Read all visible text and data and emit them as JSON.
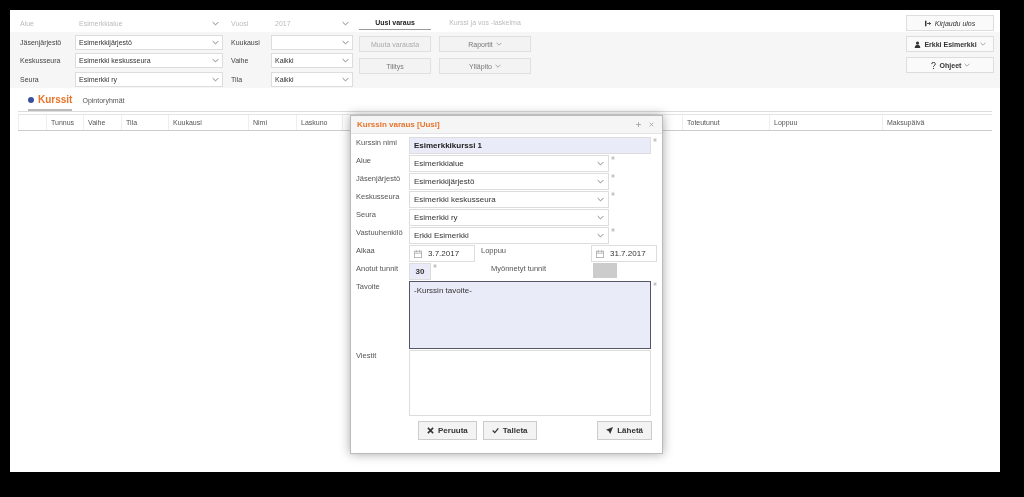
{
  "filters_left": [
    {
      "label": "Alue",
      "value": "Esimerkkialue",
      "disabled": true
    },
    {
      "label": "Jäsenjärjestö",
      "value": "Esimerkkijärjestö",
      "disabled": false
    },
    {
      "label": "Keskusseura",
      "value": "Esimerkki keskusseura",
      "disabled": false
    },
    {
      "label": "Seura",
      "value": "Esimerkki ry",
      "disabled": false
    }
  ],
  "filters_right": [
    {
      "label": "Vuosi",
      "value": "2017",
      "disabled": true
    },
    {
      "label": "Kuukausi",
      "disabled": false
    },
    {
      "label": "Vaihe",
      "value": "Kaikki",
      "disabled": false
    },
    {
      "label": "Tila",
      "value": "Kaikki",
      "disabled": false
    }
  ],
  "actions": [
    {
      "label": "Uusi varaus",
      "kind": "link",
      "disabled": false
    },
    {
      "label": "Kurssi ja vos -laskelma",
      "kind": "link",
      "disabled": true
    },
    {
      "label": "Muuta varausta",
      "kind": "button",
      "disabled": true,
      "dropdown": false
    },
    {
      "label": "Raportit",
      "kind": "button",
      "disabled": false,
      "dropdown": true
    },
    {
      "label": "Tilitys",
      "kind": "button",
      "disabled": false,
      "dropdown": false
    },
    {
      "label": "Ylläpito",
      "kind": "button",
      "disabled": false,
      "dropdown": true
    }
  ],
  "account": {
    "logout": "Kirjaudu ulos",
    "user": "Erkki Esimerkki",
    "help": "Ohjeet"
  },
  "tabs": [
    {
      "label": "Kurssit",
      "selected": true
    },
    {
      "label": "Opintoryhmät",
      "selected": false
    }
  ],
  "table": {
    "columns": [
      "Tunnus",
      "Vaihe",
      "Tila",
      "Kuukausi",
      "Nimi",
      "Laskuno",
      "Toteutunut",
      "Loppuu",
      "Maksupäivä"
    ]
  },
  "dialog": {
    "title": "Kurssin varaus [Uusi]",
    "fields": [
      {
        "kind": "text",
        "label": "Kurssin nimi",
        "value": "Esimerkkikurssi 1",
        "required": true
      },
      {
        "kind": "select",
        "label": "Alue",
        "value": "Esimerkkialue",
        "required": true
      },
      {
        "kind": "select",
        "label": "Jäsenjärjestö",
        "value": "Esimerkkijärjestö",
        "required": true
      },
      {
        "kind": "select",
        "label": "Keskusseura",
        "value": "Esimerkki keskusseura",
        "required": true
      },
      {
        "kind": "select",
        "label": "Seura",
        "value": "Esimerkki ry",
        "required": false
      },
      {
        "kind": "select",
        "label": "Vastuuhenkilö",
        "value": "Erkki Esimerkki",
        "required": true
      },
      {
        "kind": "dates",
        "label": "Alkaa",
        "value": "3.7.2017",
        "label2": "Loppuu",
        "value2": "31.7.2017"
      },
      {
        "kind": "hours",
        "label": "Anotut tunnit",
        "value": "30",
        "required": true,
        "label2": "Myönnetyt tunnit"
      },
      {
        "kind": "textarea",
        "label": "Tavoite",
        "value": "-Kurssin tavoite-",
        "required": true,
        "focused": true
      },
      {
        "kind": "textarea",
        "label": "Viestit",
        "required": false,
        "focused": false
      }
    ],
    "buttons": [
      {
        "label": "Peruuta",
        "kind": "cancel"
      },
      {
        "label": "Talleta",
        "kind": "save"
      },
      {
        "label": "Lähetä",
        "kind": "send"
      }
    ]
  }
}
